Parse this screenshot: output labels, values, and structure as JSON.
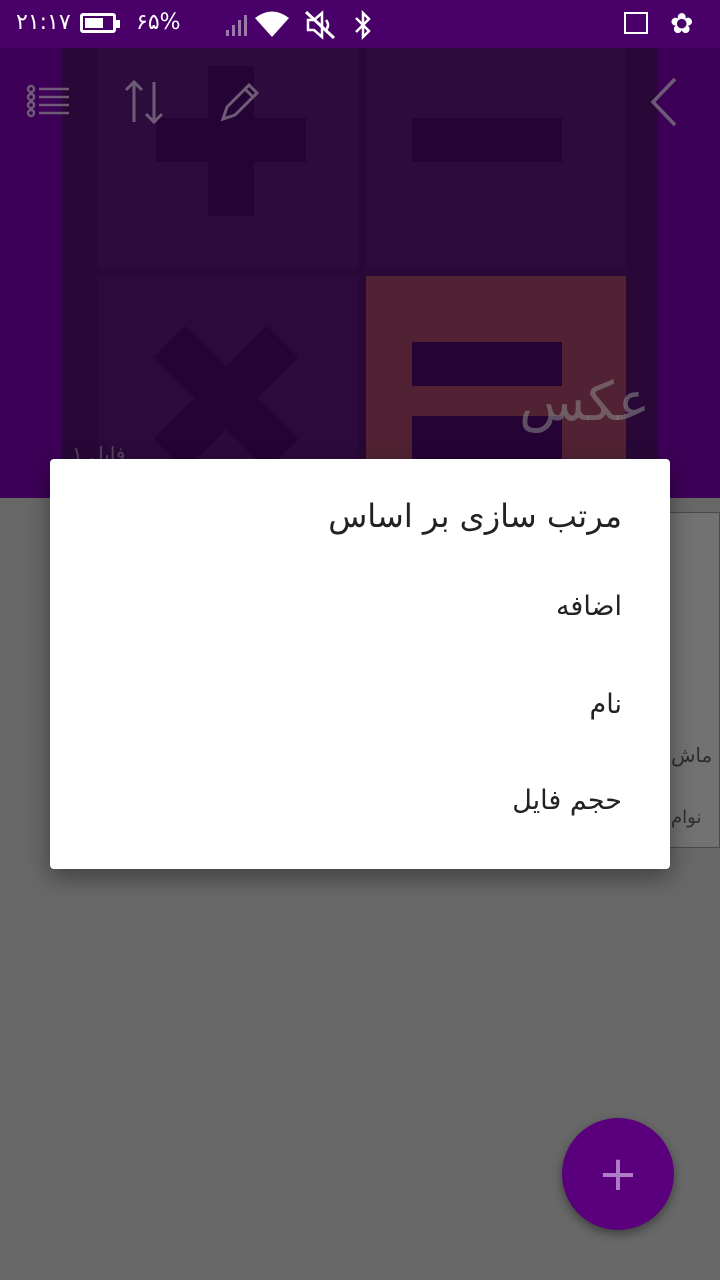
{
  "status_bar": {
    "time": "۲۱:۱۷",
    "battery_percent_text": "۶۵%",
    "battery_level": 0.65,
    "icons": [
      "battery-icon",
      "signal-icon",
      "wifi-icon",
      "mute-icon",
      "bluetooth-icon",
      "image-icon",
      "settings-icon"
    ]
  },
  "header": {
    "album_title": "عکس",
    "file_count": "۱ فایل",
    "toolbar_icons": [
      "back-icon",
      "edit-icon",
      "sort-icon",
      "list-icon"
    ],
    "accent_color": "#7a00a8"
  },
  "background_peek": {
    "line1": "ماش",
    "line2": "نوام"
  },
  "dialog": {
    "title": "مرتب سازی بر اساس",
    "options": [
      {
        "label": "اضافه"
      },
      {
        "label": "نام"
      },
      {
        "label": "حجم فایل"
      }
    ]
  },
  "fab": {
    "label": "+",
    "color": "#5a007d"
  }
}
